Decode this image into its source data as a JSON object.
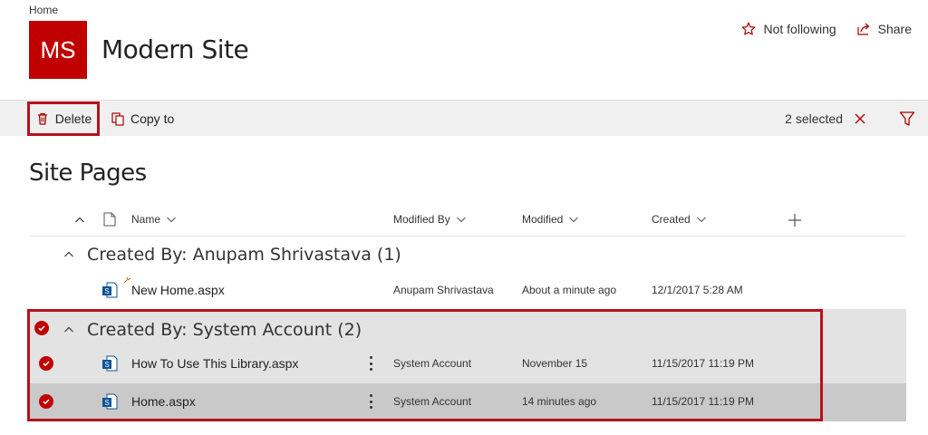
{
  "breadcrumb": "Home",
  "site": {
    "logo_text": "MS",
    "title": "Modern Site",
    "logo_color": "#c00000"
  },
  "header_actions": {
    "follow_label": "Not following",
    "share_label": "Share"
  },
  "commandbar": {
    "delete_label": "Delete",
    "copy_label": "Copy to",
    "selected_text": "2 selected"
  },
  "list": {
    "title": "Site Pages",
    "columns": {
      "name": "Name",
      "modified_by": "Modified By",
      "modified": "Modified",
      "created": "Created"
    },
    "groups": [
      {
        "label": "Created By: Anupam Shrivastava (1)",
        "items": [
          {
            "name": "New Home.aspx",
            "modified_by": "Anupam Shrivastava",
            "modified": "About a minute ago",
            "created": "12/1/2017 5:28 AM"
          }
        ]
      },
      {
        "label": "Created By: System Account (2)",
        "items": [
          {
            "name": "How To Use This Library.aspx",
            "modified_by": "System Account",
            "modified": "November 15",
            "created": "11/15/2017 11:19 PM"
          },
          {
            "name": "Home.aspx",
            "modified_by": "System Account",
            "modified": "14 minutes ago",
            "created": "11/15/2017 11:19 PM"
          }
        ]
      }
    ]
  },
  "colors": {
    "accent": "#c00000",
    "highlight_border": "#b5121b",
    "commandbar_bg": "#f0f0f0"
  }
}
